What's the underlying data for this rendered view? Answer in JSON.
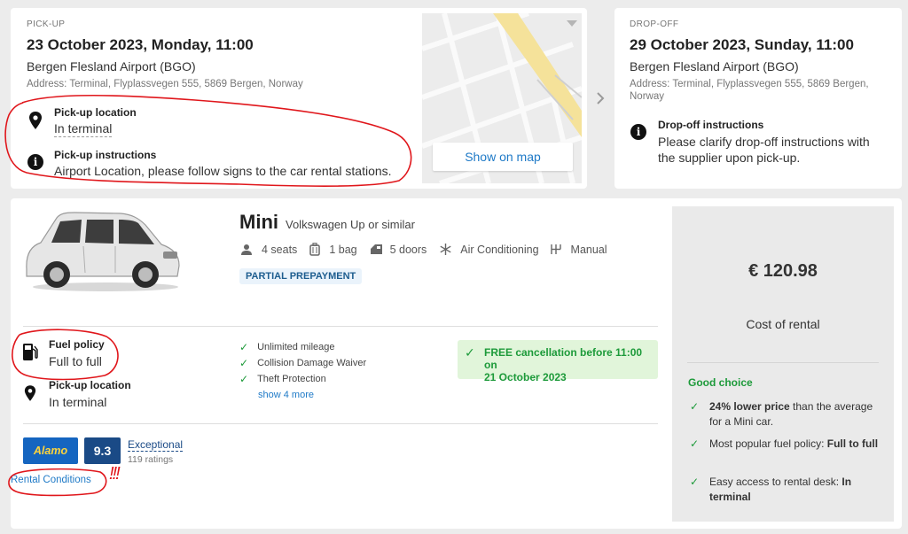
{
  "pickup": {
    "heading": "PICK-UP",
    "datetime": "23 October 2023, Monday, 11:00",
    "location": "Bergen Flesland Airport (BGO)",
    "address": "Address: Terminal, Flyplassvegen 555, 5869 Bergen, Norway",
    "loc_title": "Pick-up location",
    "loc_value": "In terminal",
    "instr_title": "Pick-up instructions",
    "instr_value": "Airport Location, please follow signs to the car rental stations.",
    "map_button": "Show on map"
  },
  "dropoff": {
    "heading": "DROP-OFF",
    "datetime": "29 October 2023, Sunday, 11:00",
    "location": "Bergen Flesland Airport (BGO)",
    "address_line1": "Address: Terminal, Flyplassvegen 555, 5869 Bergen,",
    "address_line2": "Norway",
    "instr_title": "Drop-off instructions",
    "instr_line1": "Please clarify drop-off instructions with",
    "instr_line2": "the supplier upon pick-up."
  },
  "car": {
    "category": "Mini",
    "model": "Volkswagen Up or similar",
    "features": [
      "4 seats",
      "1 bag",
      "5 doors",
      "Air Conditioning",
      "Manual"
    ],
    "badge": "PARTIAL PREPAYMENT",
    "fuel_title": "Fuel policy",
    "fuel_value": "Full to full",
    "pickup_title": "Pick-up location",
    "pickup_value": "In terminal",
    "inclusions": [
      "Unlimited mileage",
      "Collision Damage Waiver",
      "Theft Protection"
    ],
    "show_more": "show 4 more",
    "cancellation_line1": "FREE cancellation before 11:00 on",
    "cancellation_line2": "21 October 2023",
    "supplier": "Alamo",
    "score": "9.3",
    "score_label": "Exceptional",
    "ratings": "119 ratings",
    "rental_conditions": "Rental Conditions",
    "annotation": "!!!"
  },
  "price": {
    "amount": "€ 120.98",
    "label": "Cost of rental",
    "good_choice": "Good choice",
    "items": [
      {
        "bold": "24% lower price",
        "rest": " than the average for a Mini car."
      },
      {
        "pre": "Most popular fuel policy: ",
        "bold": "Full to full"
      },
      {
        "pre": "Easy access to rental desk: ",
        "bold": "In terminal"
      }
    ]
  },
  "colors": {
    "accent_blue": "#1f7ac7",
    "green": "#1d9a3a",
    "annotation_red": "#e0161b",
    "alamo_blue": "#1565c0"
  }
}
